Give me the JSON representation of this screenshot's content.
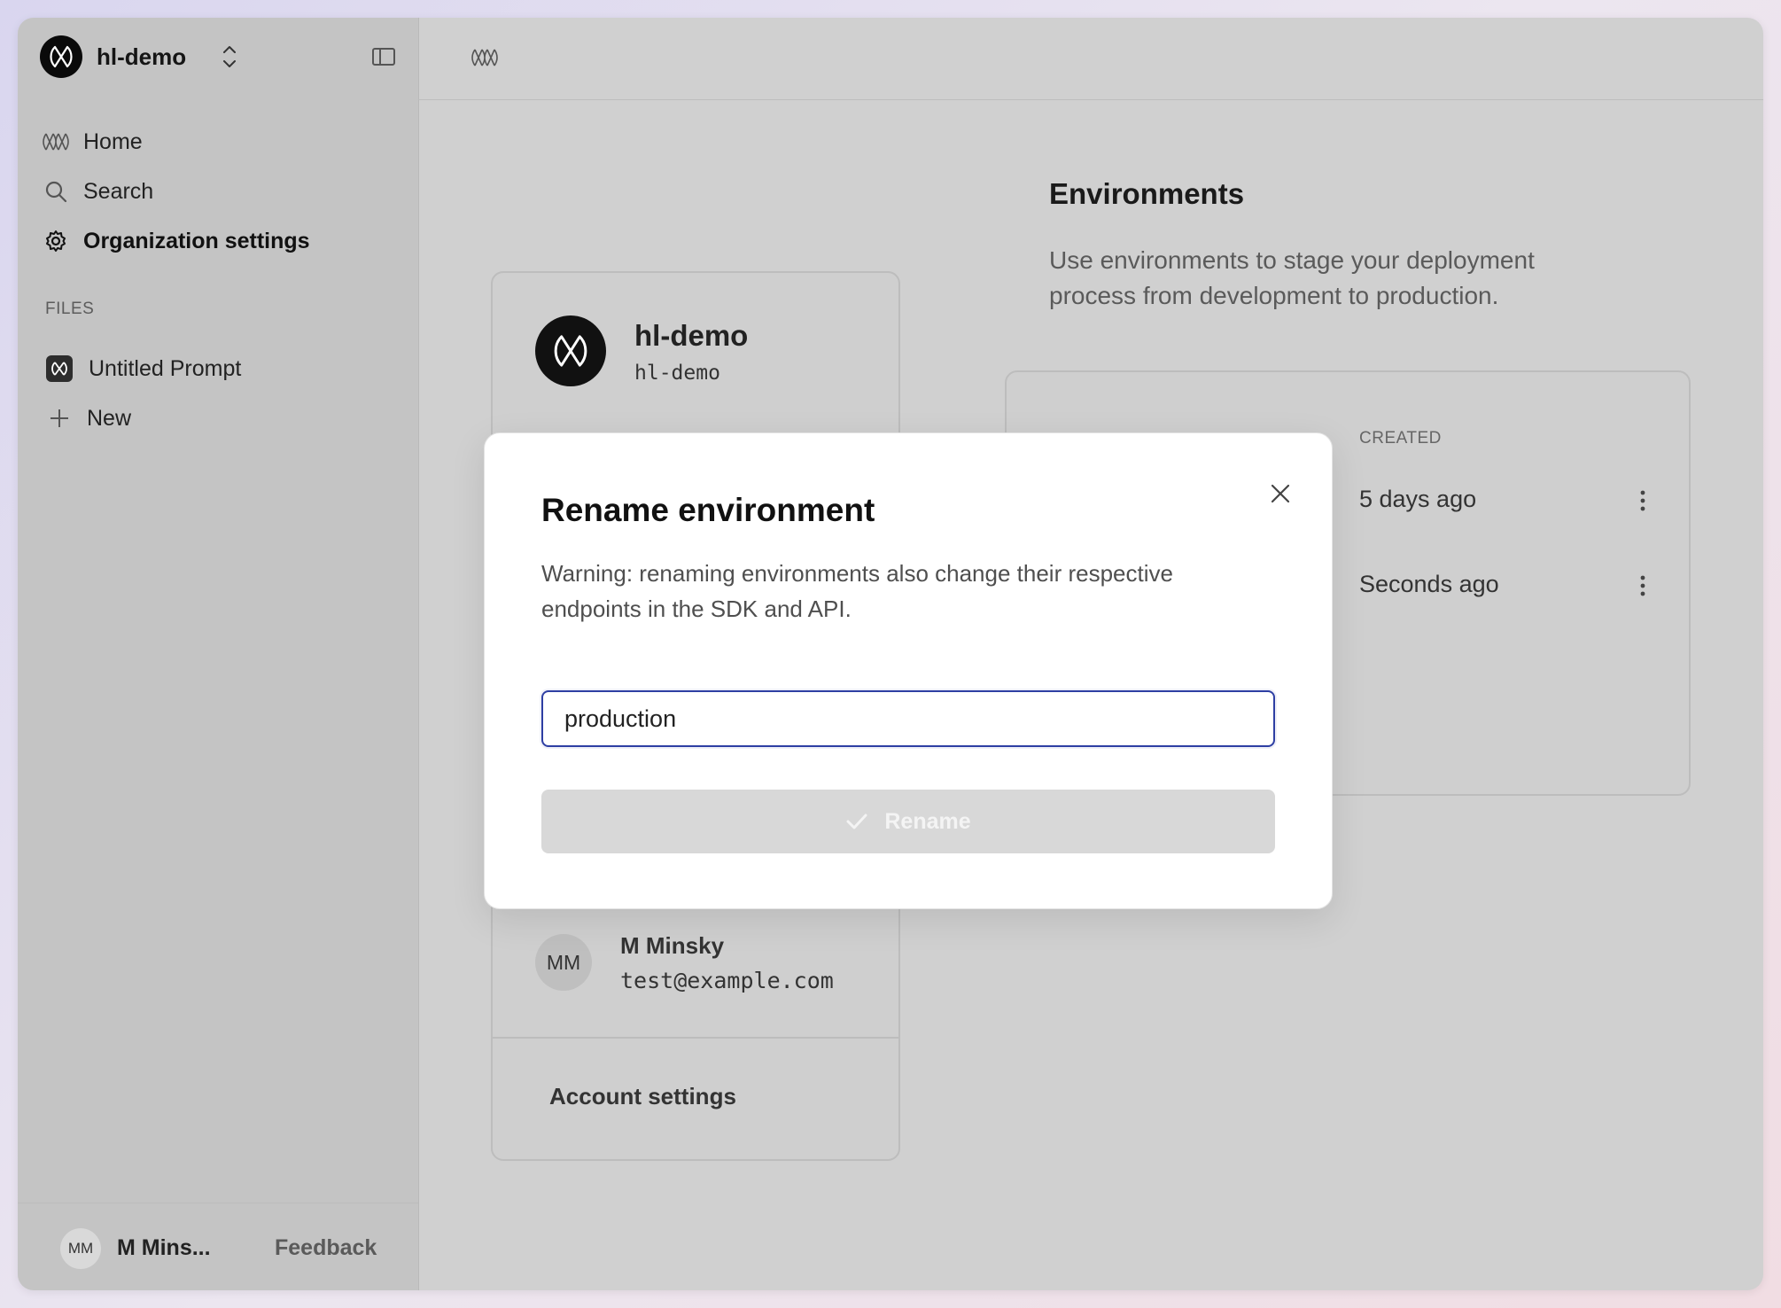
{
  "sidebar": {
    "org_name": "hl-demo",
    "nav": [
      {
        "label": "Home",
        "icon": "logo-icon"
      },
      {
        "label": "Search",
        "icon": "search-icon"
      },
      {
        "label": "Organization settings",
        "icon": "gear-icon"
      }
    ],
    "files_label": "FILES",
    "files": [
      {
        "label": "Untitled Prompt",
        "icon": "prompt-icon"
      },
      {
        "label": "New",
        "icon": "plus-icon"
      }
    ],
    "footer": {
      "avatar_initials": "MM",
      "user_name": "M Mins...",
      "feedback_label": "Feedback"
    }
  },
  "org_card": {
    "name": "hl-demo",
    "slug": "hl-demo"
  },
  "user_card": {
    "initials": "MM",
    "name": "M Minsky",
    "email": "test@example.com",
    "account_settings_label": "Account settings"
  },
  "environments": {
    "title": "Environments",
    "description": "Use environments to stage your deployment process from development to production.",
    "column_created": "CREATED",
    "rows": [
      {
        "created": "5 days ago"
      },
      {
        "created": "Seconds ago"
      }
    ]
  },
  "modal": {
    "title": "Rename environment",
    "warning": "Warning: renaming environments also change their respective endpoints in the SDK and API.",
    "input_value": "production",
    "button_label": "Rename"
  },
  "colors": {
    "input_focus_border": "#2e3fa3",
    "button_disabled_bg": "#d8d8d8",
    "overlay": "#d0d0d0"
  }
}
